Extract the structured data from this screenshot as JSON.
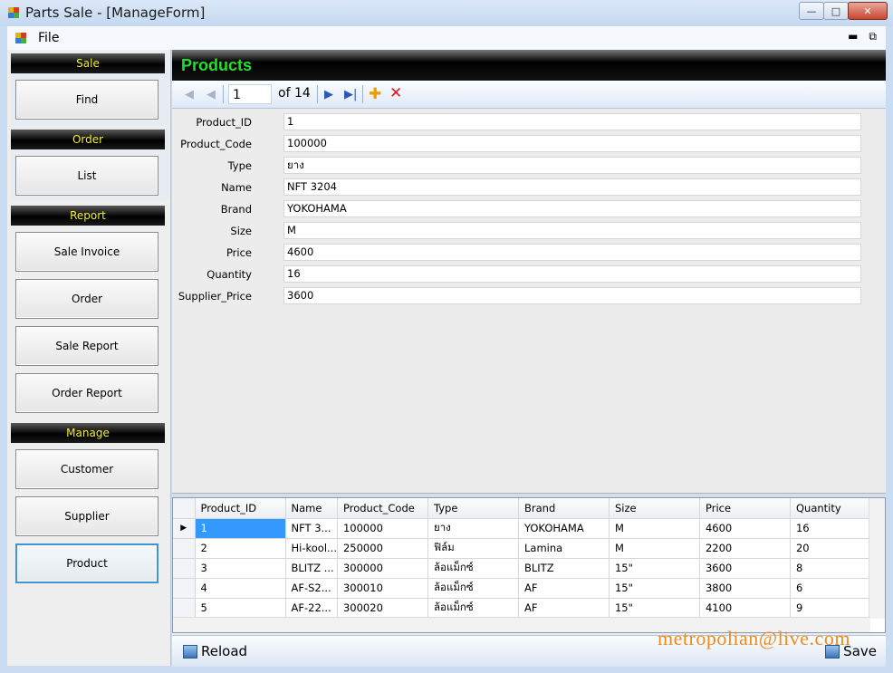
{
  "window": {
    "title": "Parts Sale - [ManageForm]"
  },
  "menu": {
    "file": "File"
  },
  "sidebar": {
    "sections": [
      {
        "title": "Sale",
        "buttons": [
          "Find"
        ]
      },
      {
        "title": "Order",
        "buttons": [
          "List"
        ]
      },
      {
        "title": "Report",
        "buttons": [
          "Sale Invoice",
          "Order",
          "Sale Report",
          "Order Report"
        ]
      },
      {
        "title": "Manage",
        "buttons": [
          "Customer",
          "Supplier",
          "Product"
        ]
      }
    ]
  },
  "header": {
    "title": "Products"
  },
  "navigator": {
    "position": "1",
    "count_text": "of 14"
  },
  "form": {
    "fields": [
      {
        "label": "Product_ID",
        "value": "1"
      },
      {
        "label": "Product_Code",
        "value": "100000"
      },
      {
        "label": "Type",
        "value": "ยาง"
      },
      {
        "label": "Name",
        "value": "NFT 3204"
      },
      {
        "label": "Brand",
        "value": "YOKOHAMA"
      },
      {
        "label": "Size",
        "value": "M"
      },
      {
        "label": "Price",
        "value": "4600"
      },
      {
        "label": "Quantity",
        "value": "16"
      },
      {
        "label": "Supplier_Price",
        "value": "3600"
      }
    ]
  },
  "grid": {
    "columns": [
      "Product_ID",
      "Name",
      "Product_Code",
      "Type",
      "Brand",
      "Size",
      "Price",
      "Quantity"
    ],
    "rows": [
      [
        "1",
        "NFT 3...",
        "100000",
        "ยาง",
        "YOKOHAMA",
        "M",
        "4600",
        "16"
      ],
      [
        "2",
        "Hi-kool...",
        "250000",
        "ฟิล์ม",
        "Lamina",
        "M",
        "2200",
        "20"
      ],
      [
        "3",
        "BLITZ ...",
        "300000",
        "ล้อแม็กซ์",
        "BLITZ",
        "15\"",
        "3600",
        "8"
      ],
      [
        "4",
        "AF-S2...",
        "300010",
        "ล้อแม็กซ์",
        "AF",
        "15\"",
        "3800",
        "6"
      ],
      [
        "5",
        "AF-22...",
        "300020",
        "ล้อแม็กซ์",
        "AF",
        "15\"",
        "4100",
        "9"
      ]
    ]
  },
  "footer": {
    "reload": "Reload",
    "save": "Save"
  },
  "watermark": "metropolian@live.com"
}
